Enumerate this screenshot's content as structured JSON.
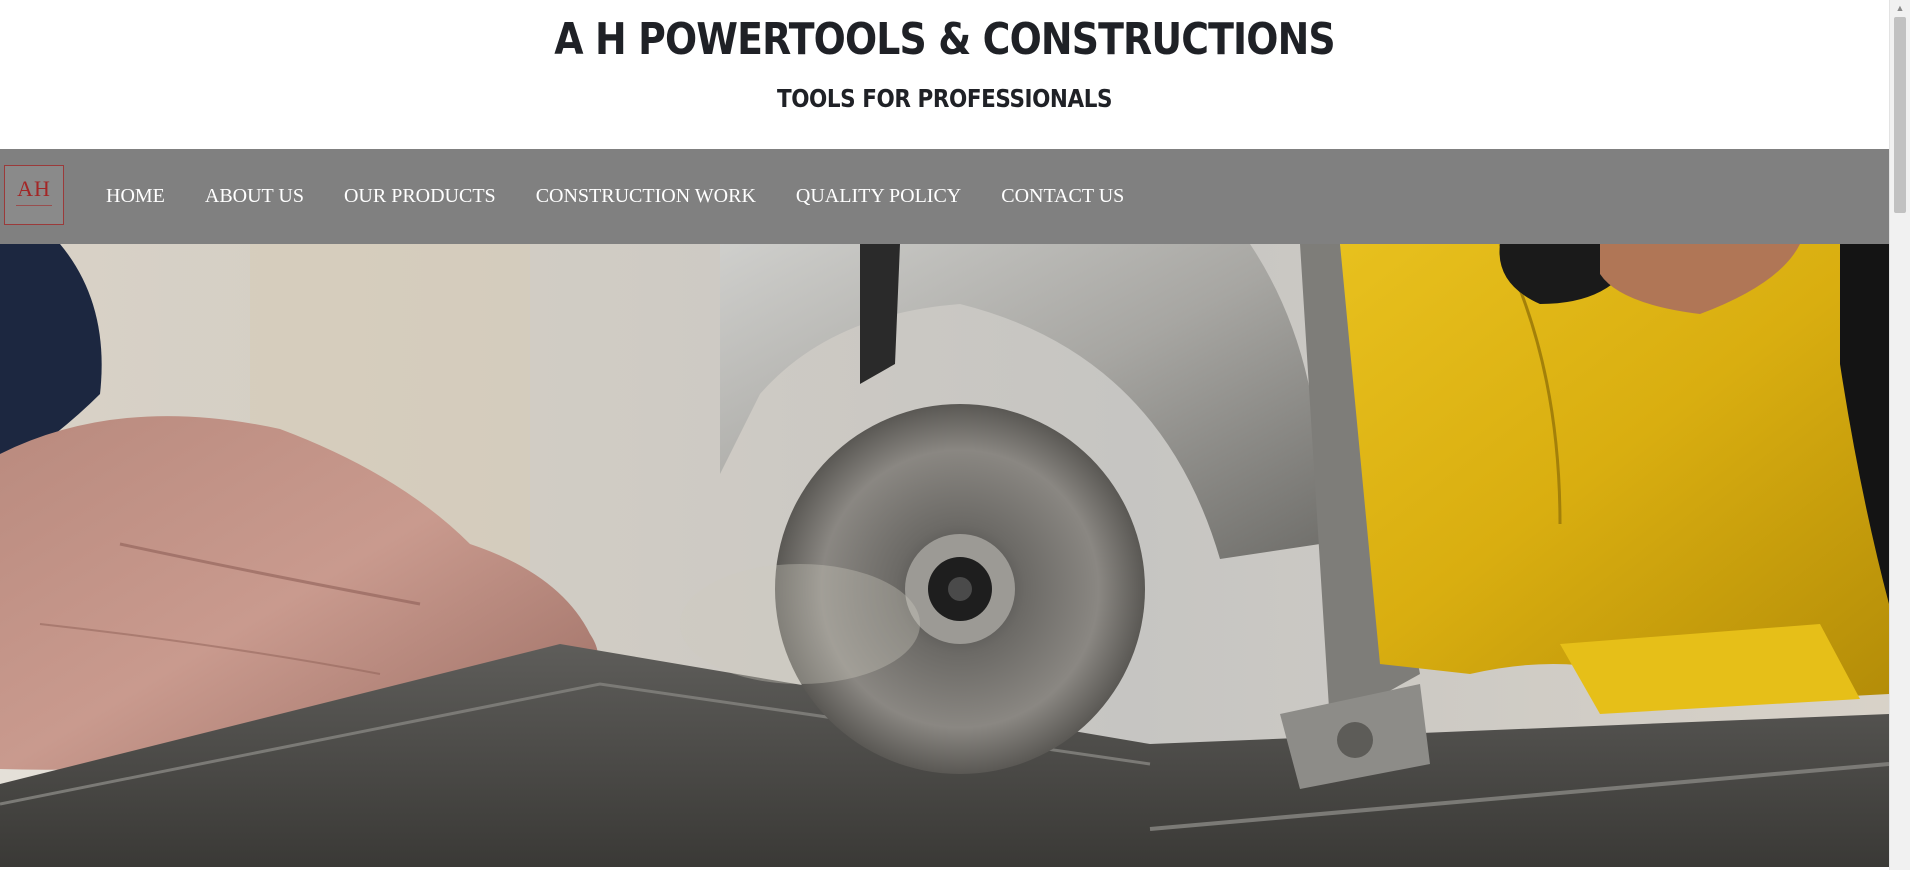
{
  "header": {
    "title": "A H POWERTOOLS & CONSTRUCTIONS",
    "tagline": "TOOLS FOR PROFESSIONALS"
  },
  "logo": {
    "text": "AH"
  },
  "nav": {
    "items": [
      {
        "label": "HOME"
      },
      {
        "label": "ABOUT US"
      },
      {
        "label": "OUR PRODUCTS"
      },
      {
        "label": "CONSTRUCTION WORK"
      },
      {
        "label": "QUALITY POLICY"
      },
      {
        "label": "CONTACT US"
      }
    ]
  },
  "colors": {
    "nav_background": "#808080",
    "title_text": "#1f2126",
    "logo_accent": "#a32626"
  },
  "hero": {
    "icon": "circular-saw-photo"
  }
}
